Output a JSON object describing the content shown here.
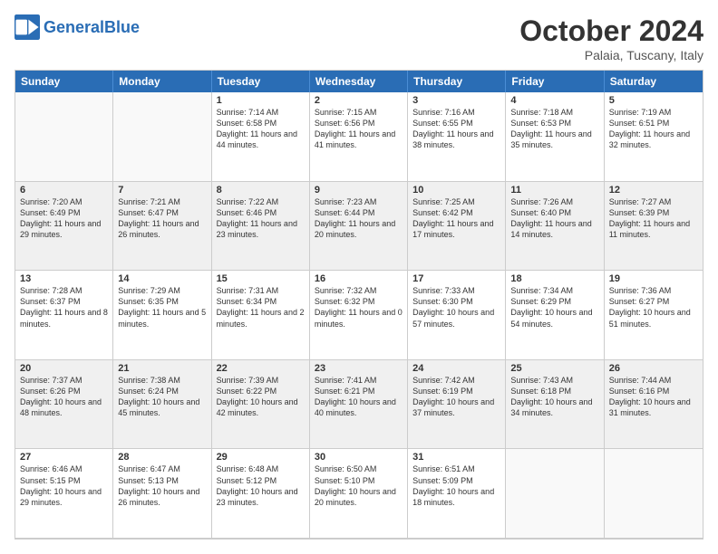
{
  "header": {
    "logo_general": "General",
    "logo_blue": "Blue",
    "title": "October 2024",
    "subtitle": "Palaia, Tuscany, Italy"
  },
  "day_headers": [
    "Sunday",
    "Monday",
    "Tuesday",
    "Wednesday",
    "Thursday",
    "Friday",
    "Saturday"
  ],
  "weeks": [
    [
      {
        "day": "",
        "content": "",
        "empty": true
      },
      {
        "day": "",
        "content": "",
        "empty": true
      },
      {
        "day": "1",
        "content": "Sunrise: 7:14 AM\nSunset: 6:58 PM\nDaylight: 11 hours and 44 minutes.",
        "empty": false
      },
      {
        "day": "2",
        "content": "Sunrise: 7:15 AM\nSunset: 6:56 PM\nDaylight: 11 hours and 41 minutes.",
        "empty": false
      },
      {
        "day": "3",
        "content": "Sunrise: 7:16 AM\nSunset: 6:55 PM\nDaylight: 11 hours and 38 minutes.",
        "empty": false
      },
      {
        "day": "4",
        "content": "Sunrise: 7:18 AM\nSunset: 6:53 PM\nDaylight: 11 hours and 35 minutes.",
        "empty": false
      },
      {
        "day": "5",
        "content": "Sunrise: 7:19 AM\nSunset: 6:51 PM\nDaylight: 11 hours and 32 minutes.",
        "empty": false
      }
    ],
    [
      {
        "day": "6",
        "content": "Sunrise: 7:20 AM\nSunset: 6:49 PM\nDaylight: 11 hours and 29 minutes.",
        "empty": false
      },
      {
        "day": "7",
        "content": "Sunrise: 7:21 AM\nSunset: 6:47 PM\nDaylight: 11 hours and 26 minutes.",
        "empty": false
      },
      {
        "day": "8",
        "content": "Sunrise: 7:22 AM\nSunset: 6:46 PM\nDaylight: 11 hours and 23 minutes.",
        "empty": false
      },
      {
        "day": "9",
        "content": "Sunrise: 7:23 AM\nSunset: 6:44 PM\nDaylight: 11 hours and 20 minutes.",
        "empty": false
      },
      {
        "day": "10",
        "content": "Sunrise: 7:25 AM\nSunset: 6:42 PM\nDaylight: 11 hours and 17 minutes.",
        "empty": false
      },
      {
        "day": "11",
        "content": "Sunrise: 7:26 AM\nSunset: 6:40 PM\nDaylight: 11 hours and 14 minutes.",
        "empty": false
      },
      {
        "day": "12",
        "content": "Sunrise: 7:27 AM\nSunset: 6:39 PM\nDaylight: 11 hours and 11 minutes.",
        "empty": false
      }
    ],
    [
      {
        "day": "13",
        "content": "Sunrise: 7:28 AM\nSunset: 6:37 PM\nDaylight: 11 hours and 8 minutes.",
        "empty": false
      },
      {
        "day": "14",
        "content": "Sunrise: 7:29 AM\nSunset: 6:35 PM\nDaylight: 11 hours and 5 minutes.",
        "empty": false
      },
      {
        "day": "15",
        "content": "Sunrise: 7:31 AM\nSunset: 6:34 PM\nDaylight: 11 hours and 2 minutes.",
        "empty": false
      },
      {
        "day": "16",
        "content": "Sunrise: 7:32 AM\nSunset: 6:32 PM\nDaylight: 11 hours and 0 minutes.",
        "empty": false
      },
      {
        "day": "17",
        "content": "Sunrise: 7:33 AM\nSunset: 6:30 PM\nDaylight: 10 hours and 57 minutes.",
        "empty": false
      },
      {
        "day": "18",
        "content": "Sunrise: 7:34 AM\nSunset: 6:29 PM\nDaylight: 10 hours and 54 minutes.",
        "empty": false
      },
      {
        "day": "19",
        "content": "Sunrise: 7:36 AM\nSunset: 6:27 PM\nDaylight: 10 hours and 51 minutes.",
        "empty": false
      }
    ],
    [
      {
        "day": "20",
        "content": "Sunrise: 7:37 AM\nSunset: 6:26 PM\nDaylight: 10 hours and 48 minutes.",
        "empty": false
      },
      {
        "day": "21",
        "content": "Sunrise: 7:38 AM\nSunset: 6:24 PM\nDaylight: 10 hours and 45 minutes.",
        "empty": false
      },
      {
        "day": "22",
        "content": "Sunrise: 7:39 AM\nSunset: 6:22 PM\nDaylight: 10 hours and 42 minutes.",
        "empty": false
      },
      {
        "day": "23",
        "content": "Sunrise: 7:41 AM\nSunset: 6:21 PM\nDaylight: 10 hours and 40 minutes.",
        "empty": false
      },
      {
        "day": "24",
        "content": "Sunrise: 7:42 AM\nSunset: 6:19 PM\nDaylight: 10 hours and 37 minutes.",
        "empty": false
      },
      {
        "day": "25",
        "content": "Sunrise: 7:43 AM\nSunset: 6:18 PM\nDaylight: 10 hours and 34 minutes.",
        "empty": false
      },
      {
        "day": "26",
        "content": "Sunrise: 7:44 AM\nSunset: 6:16 PM\nDaylight: 10 hours and 31 minutes.",
        "empty": false
      }
    ],
    [
      {
        "day": "27",
        "content": "Sunrise: 6:46 AM\nSunset: 5:15 PM\nDaylight: 10 hours and 29 minutes.",
        "empty": false
      },
      {
        "day": "28",
        "content": "Sunrise: 6:47 AM\nSunset: 5:13 PM\nDaylight: 10 hours and 26 minutes.",
        "empty": false
      },
      {
        "day": "29",
        "content": "Sunrise: 6:48 AM\nSunset: 5:12 PM\nDaylight: 10 hours and 23 minutes.",
        "empty": false
      },
      {
        "day": "30",
        "content": "Sunrise: 6:50 AM\nSunset: 5:10 PM\nDaylight: 10 hours and 20 minutes.",
        "empty": false
      },
      {
        "day": "31",
        "content": "Sunrise: 6:51 AM\nSunset: 5:09 PM\nDaylight: 10 hours and 18 minutes.",
        "empty": false
      },
      {
        "day": "",
        "content": "",
        "empty": true
      },
      {
        "day": "",
        "content": "",
        "empty": true
      }
    ]
  ]
}
